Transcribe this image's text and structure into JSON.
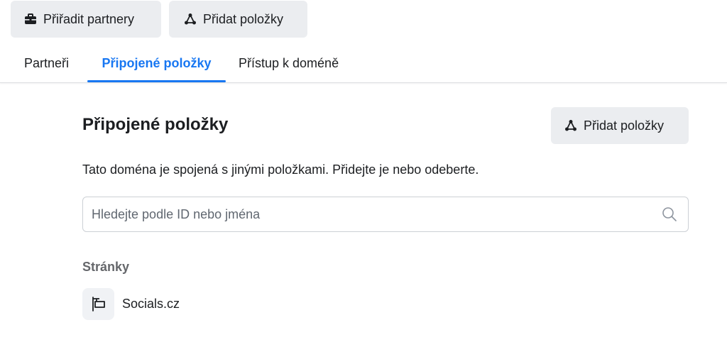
{
  "header": {
    "assign_partners_label": "Přiřadit partnery",
    "add_items_label": "Přidat položky"
  },
  "tabs": [
    {
      "label": "Partneři",
      "active": false
    },
    {
      "label": "Připojené položky",
      "active": true
    },
    {
      "label": "Přístup k doméně",
      "active": false
    }
  ],
  "section": {
    "title": "Připojené položky",
    "add_items_label": "Přidat položky",
    "description": "Tato doména je spojená s jinými položkami. Přidejte je nebo odeberte."
  },
  "search": {
    "placeholder": "Hledejte podle ID nebo jména",
    "value": ""
  },
  "groups": [
    {
      "label": "Stránky",
      "items": [
        {
          "name": "Socials.cz",
          "icon": "flag-page-icon"
        }
      ]
    }
  ],
  "icons": {
    "assign_partners": "briefcase-icon",
    "add_items": "share-nodes-icon",
    "search": "magnifier-icon"
  },
  "colors": {
    "accent": "#1877f2",
    "button_bg": "#ebedf0",
    "text": "#1c1e21",
    "muted": "#65676b"
  }
}
